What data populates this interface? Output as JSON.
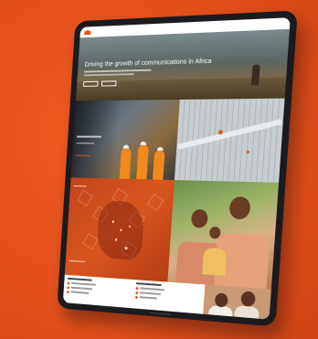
{
  "hero": {
    "headline": "Driving the growth of communications in Africa"
  },
  "colors": {
    "background": "#e8511c",
    "accent": "#e8511c",
    "device": "#1b1b1f"
  },
  "icons": {
    "logo": "company-logo-mark"
  }
}
